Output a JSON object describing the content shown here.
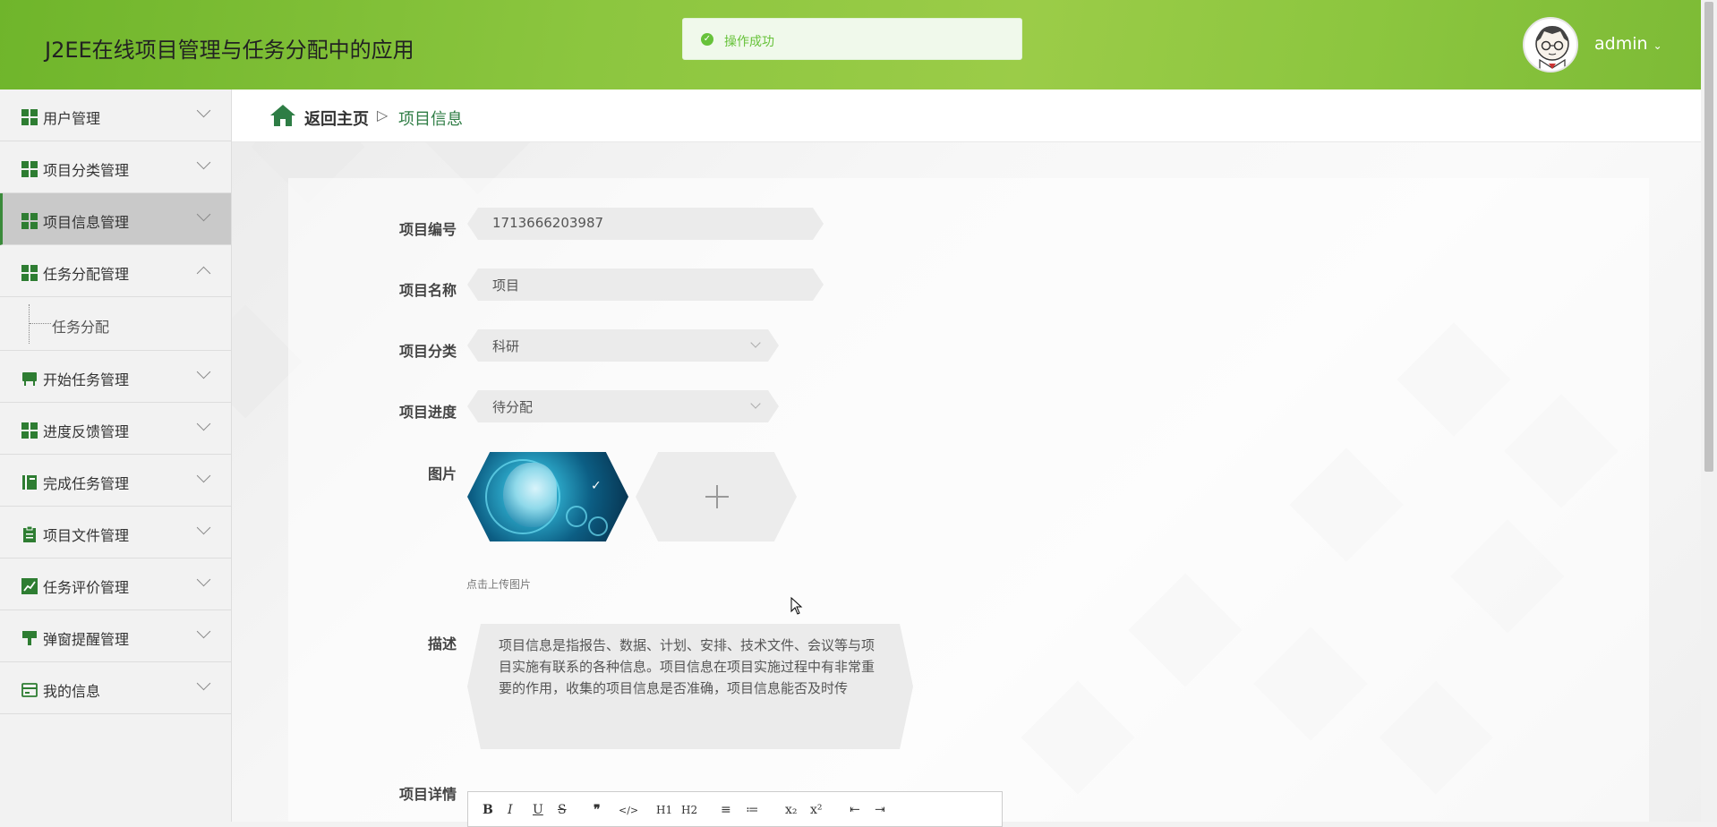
{
  "header": {
    "title": "J2EE在线项目管理与任务分配中的应用",
    "username": "admin",
    "toast": "操作成功"
  },
  "sidebar": {
    "items": [
      {
        "label": "用户管理",
        "icon": "grid-icon"
      },
      {
        "label": "项目分类管理",
        "icon": "grid-icon"
      },
      {
        "label": "项目信息管理",
        "icon": "grid-icon",
        "active": true
      },
      {
        "label": "任务分配管理",
        "icon": "grid-icon",
        "expanded": true
      },
      {
        "label": "开始任务管理",
        "icon": "desk-icon"
      },
      {
        "label": "进度反馈管理",
        "icon": "grid-icon"
      },
      {
        "label": "完成任务管理",
        "icon": "book-icon"
      },
      {
        "label": "项目文件管理",
        "icon": "clipboard-icon"
      },
      {
        "label": "任务评价管理",
        "icon": "chart-icon"
      },
      {
        "label": "弹窗提醒管理",
        "icon": "brush-icon"
      },
      {
        "label": "我的信息",
        "icon": "card-icon"
      }
    ],
    "subitem": "任务分配"
  },
  "breadcrumb": {
    "home": "返回主页",
    "separator": "▷",
    "current": "项目信息"
  },
  "form": {
    "code_label": "项目编号",
    "code_value": "1713666203987",
    "name_label": "项目名称",
    "name_value": "项目",
    "category_label": "项目分类",
    "category_value": "科研",
    "progress_label": "项目进度",
    "progress_value": "待分配",
    "image_label": "图片",
    "image_tip": "点击上传图片",
    "desc_label": "描述",
    "desc_value": "项目信息是指报告、数据、计划、安排、技术文件、会议等与项目实施有联系的各种信息。项目信息在项目实施过程中有非常重要的作用，收集的项目信息是否准确，项目信息能否及时传",
    "detail_label": "项目详情"
  },
  "editor_toolbar": [
    "B",
    "I",
    "U",
    "S",
    "❞",
    "</>",
    "H1",
    "H2",
    "≡",
    "≔",
    "x₂",
    "x²",
    "⇤",
    "⇥"
  ],
  "colors": {
    "accent": "#8cc63f",
    "breadcrumb_current": "#2f7d45",
    "toast_green": "#67c23a"
  }
}
